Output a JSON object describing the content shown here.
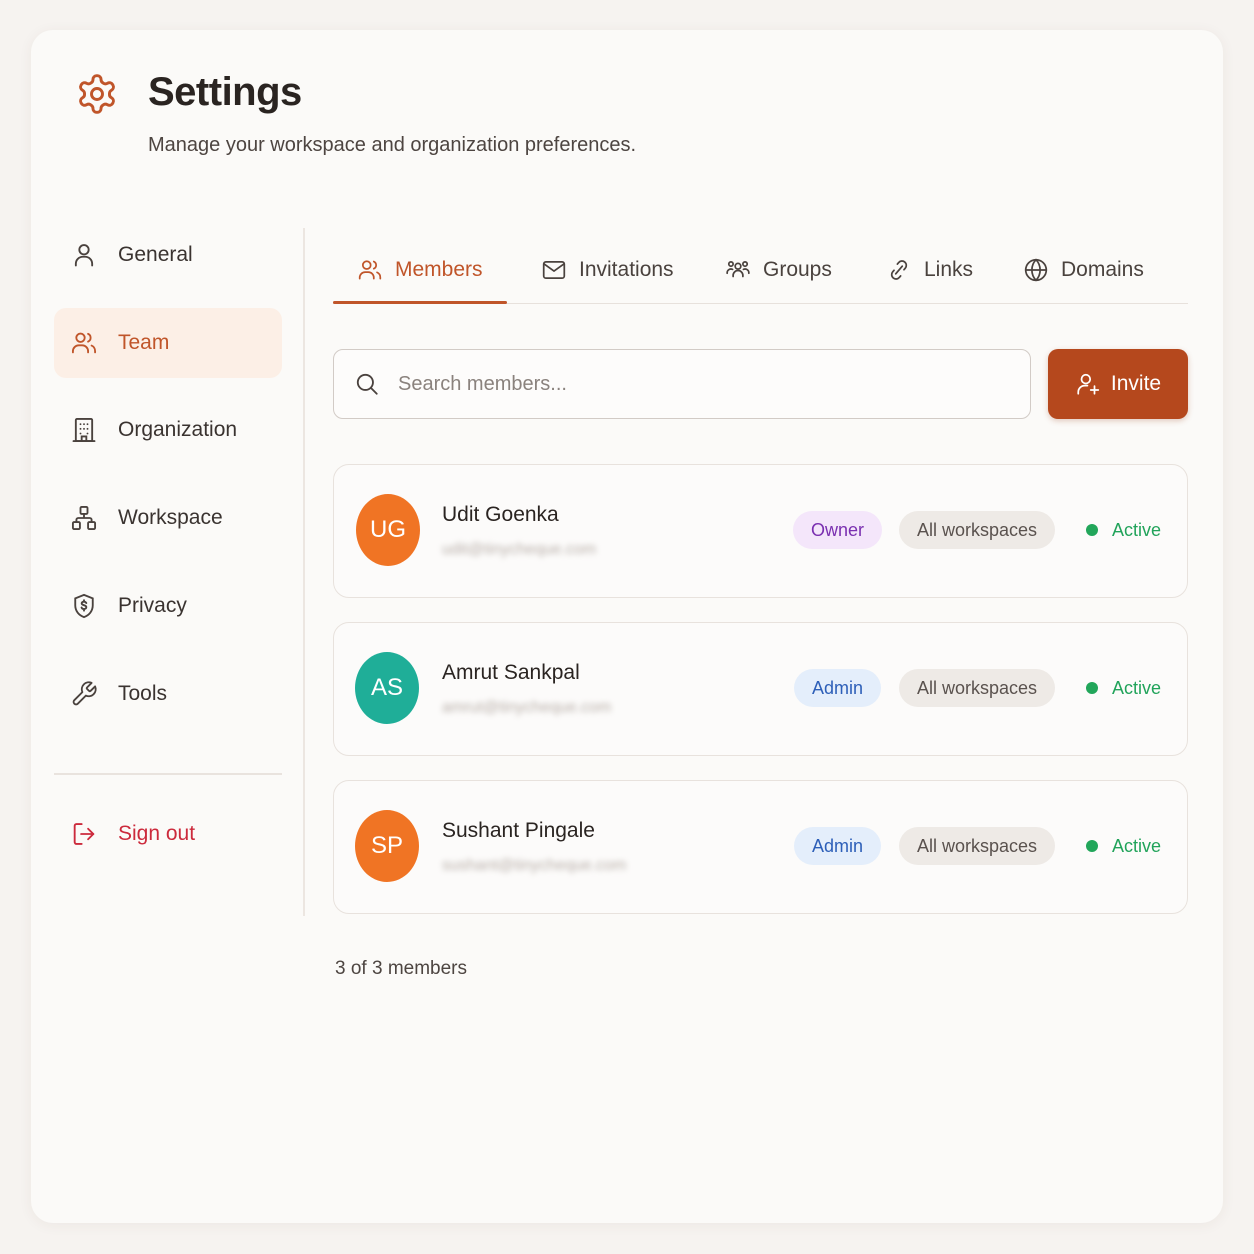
{
  "header": {
    "title": "Settings",
    "subtitle": "Manage your workspace and organization preferences.",
    "icon": "gear-icon"
  },
  "colors": {
    "accent": "#c0552a",
    "invite_bg": "#b5481d",
    "active_green": "#21a35a",
    "signout_red": "#cc2a3c"
  },
  "sidebar": {
    "items": [
      {
        "label": "General",
        "icon": "user-icon"
      },
      {
        "label": "Team",
        "icon": "users-icon",
        "active": true
      },
      {
        "label": "Organization",
        "icon": "building-icon"
      },
      {
        "label": "Workspace",
        "icon": "network-icon"
      },
      {
        "label": "Privacy",
        "icon": "shield-icon"
      },
      {
        "label": "Tools",
        "icon": "wrench-icon"
      }
    ],
    "signout": {
      "label": "Sign out",
      "icon": "logout-icon"
    }
  },
  "tabs": [
    {
      "label": "Members",
      "icon": "users-icon",
      "active": true
    },
    {
      "label": "Invitations",
      "icon": "mail-icon"
    },
    {
      "label": "Groups",
      "icon": "group-icon"
    },
    {
      "label": "Links",
      "icon": "link-icon"
    },
    {
      "label": "Domains",
      "icon": "globe-icon"
    }
  ],
  "search": {
    "placeholder": "Search members...",
    "value": ""
  },
  "invite": {
    "label": "Invite",
    "icon": "user-plus-icon"
  },
  "members": [
    {
      "initials": "UG",
      "name": "Udit Goenka",
      "email": "udit@tinycheque.com",
      "role": "Owner",
      "scope": "All workspaces",
      "status": "Active",
      "avatar_color": "#f07424"
    },
    {
      "initials": "AS",
      "name": "Amrut Sankpal",
      "email": "amrut@tinycheque.com",
      "role": "Admin",
      "scope": "All workspaces",
      "status": "Active",
      "avatar_color": "#1fae98"
    },
    {
      "initials": "SP",
      "name": "Sushant Pingale",
      "email": "sushant@tinycheque.com",
      "role": "Admin",
      "scope": "All workspaces",
      "status": "Active",
      "avatar_color": "#f07424"
    }
  ],
  "footer": {
    "count": "3 of 3 members"
  }
}
